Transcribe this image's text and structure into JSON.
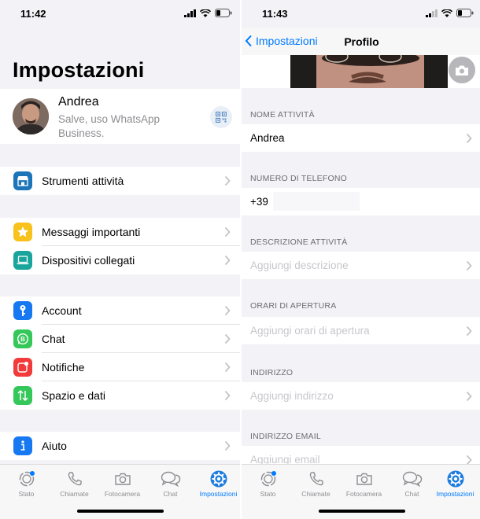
{
  "left": {
    "status_time": "11:42",
    "title": "Impostazioni",
    "profile": {
      "name": "Andrea",
      "status": "Salve, uso WhatsApp Business."
    },
    "groups": [
      [
        {
          "label": "Strumenti attività",
          "icon": "store-icon",
          "color": "#1c75b8"
        }
      ],
      [
        {
          "label": "Messaggi importanti",
          "icon": "star-icon",
          "color": "#f7c21b"
        },
        {
          "label": "Dispositivi collegati",
          "icon": "laptop-icon",
          "color": "#1aa59c"
        }
      ],
      [
        {
          "label": "Account",
          "icon": "key-icon",
          "color": "#1779f2"
        },
        {
          "label": "Chat",
          "icon": "whatsapp-business-icon",
          "color": "#35c759"
        },
        {
          "label": "Notifiche",
          "icon": "notification-icon",
          "color": "#f23a3a"
        },
        {
          "label": "Spazio e dati",
          "icon": "data-arrows-icon",
          "color": "#35c759"
        }
      ],
      [
        {
          "label": "Aiuto",
          "icon": "info-icon",
          "color": "#1779f2"
        }
      ]
    ]
  },
  "right": {
    "status_time": "11:43",
    "back_label": "Impostazioni",
    "nav_title": "Profilo",
    "sections": [
      {
        "header": "NOME ATTIVITÀ",
        "value": "Andrea",
        "placeholder": ""
      },
      {
        "header": "NUMERO DI TELEFONO",
        "value": "+39",
        "placeholder": ""
      },
      {
        "header": "DESCRIZIONE ATTIVITÀ",
        "value": "",
        "placeholder": "Aggiungi descrizione"
      },
      {
        "header": "ORARI DI APERTURA",
        "value": "",
        "placeholder": "Aggiungi orari di apertura"
      },
      {
        "header": "INDIRIZZO",
        "value": "",
        "placeholder": "Aggiungi indirizzo"
      },
      {
        "header": "INDIRIZZO EMAIL",
        "value": "",
        "placeholder": "Aggiungi email"
      }
    ]
  },
  "tabs": [
    {
      "label": "Stato",
      "icon": "status-icon"
    },
    {
      "label": "Chiamate",
      "icon": "phone-icon"
    },
    {
      "label": "Fotocamera",
      "icon": "camera-icon"
    },
    {
      "label": "Chat",
      "icon": "chat-bubbles-icon"
    },
    {
      "label": "Impostazioni",
      "icon": "settings-gear-icon",
      "active": true
    }
  ],
  "colors": {
    "accent": "#007aff",
    "background": "#f2f2f7"
  }
}
